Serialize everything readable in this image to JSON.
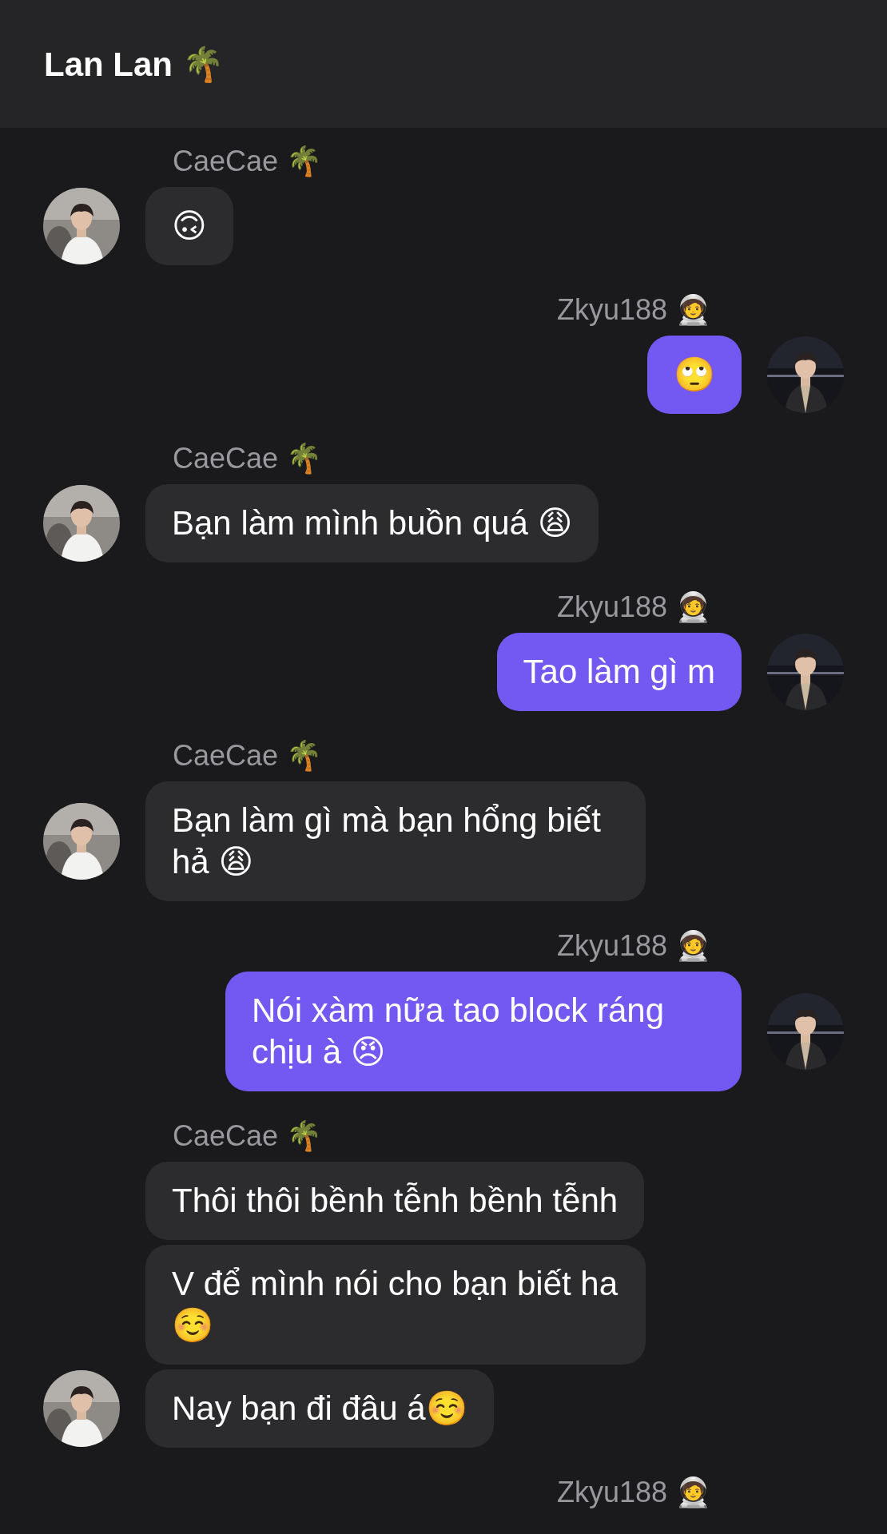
{
  "header": {
    "title": "Lan Lan 🌴"
  },
  "messages": [
    {
      "kind": "incoming",
      "sender": "CaeCae 🌴",
      "bubbles": [
        "🙃"
      ]
    },
    {
      "kind": "outgoing",
      "sender": "Zkyu188 🧑‍🚀",
      "bubbles": [
        "🙄"
      ]
    },
    {
      "kind": "incoming",
      "sender": "CaeCae 🌴",
      "bubbles": [
        "Bạn làm mình buồn quá 😩"
      ]
    },
    {
      "kind": "outgoing",
      "sender": "Zkyu188 🧑‍🚀",
      "bubbles": [
        "Tao làm gì m"
      ]
    },
    {
      "kind": "incoming",
      "sender": "CaeCae 🌴",
      "bubbles": [
        "Bạn làm gì mà bạn hổng biết hả 😩"
      ]
    },
    {
      "kind": "outgoing",
      "sender": "Zkyu188 🧑‍🚀",
      "bubbles": [
        "Nói xàm nữa tao block ráng chịu à 😠"
      ]
    },
    {
      "kind": "incoming",
      "sender": "CaeCae 🌴",
      "bubbles": [
        "Thôi thôi bềnh tễnh bềnh tễnh",
        "V để mình nói cho bạn biết ha ☺️",
        "Nay bạn đi đâu á☺️"
      ]
    },
    {
      "kind": "outgoing",
      "sender": "Zkyu188 🧑‍🚀"
    }
  ]
}
